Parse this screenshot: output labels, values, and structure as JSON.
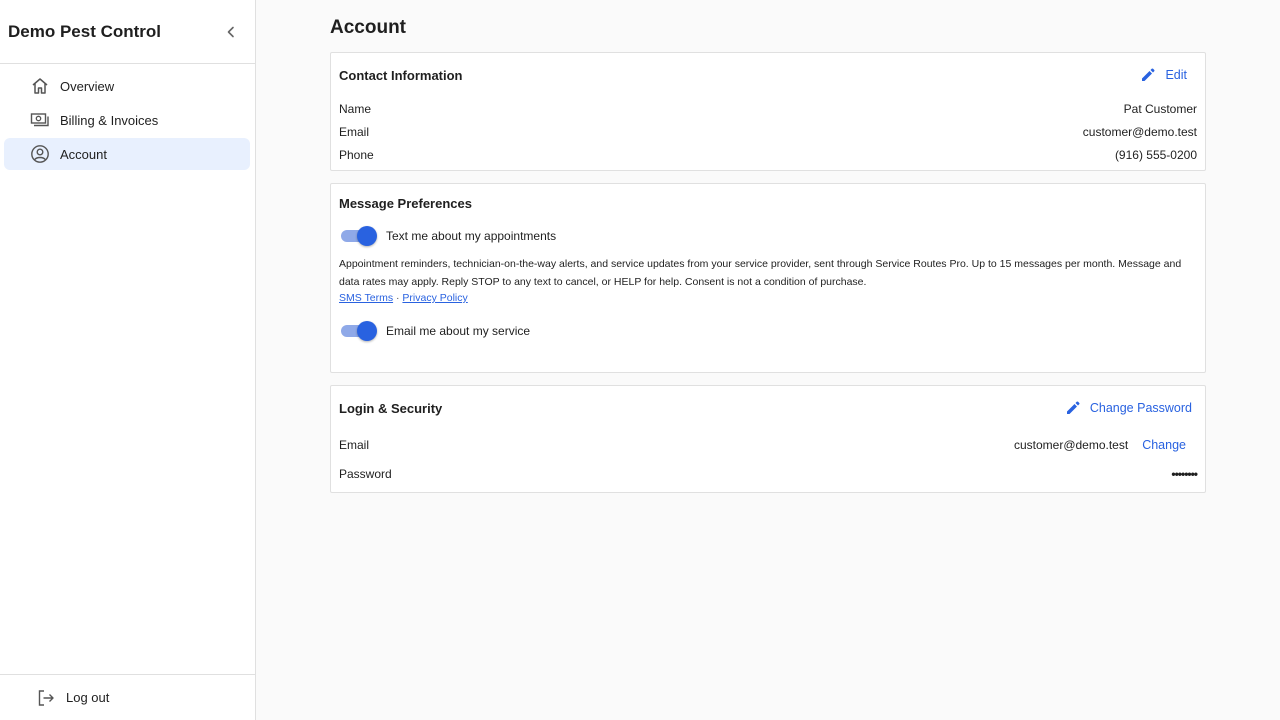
{
  "sidebar": {
    "brand": "Demo Pest Control",
    "items": [
      {
        "label": "Overview",
        "icon": "home-icon"
      },
      {
        "label": "Billing & Invoices",
        "icon": "cash-icon"
      },
      {
        "label": "Account",
        "icon": "account-circle-icon",
        "active": true
      }
    ],
    "logout_label": "Log out"
  },
  "page": {
    "title": "Account"
  },
  "contact": {
    "title": "Contact Information",
    "edit_label": "Edit",
    "rows": [
      {
        "label": "Name",
        "value": "Pat Customer"
      },
      {
        "label": "Email",
        "value": "customer@demo.test"
      },
      {
        "label": "Phone",
        "value": "(916) 555-0200"
      }
    ]
  },
  "prefs": {
    "title": "Message Preferences",
    "sms_toggle_label": "Text me about my appointments",
    "sms_enabled": true,
    "sms_description": "Appointment reminders, technician-on-the-way alerts, and service updates from your service provider, sent through Service Routes Pro. Up to 15 messages per month. Message and data rates may apply. Reply STOP to any text to cancel, or HELP for help. Consent is not a condition of purchase.",
    "sms_terms_label": "SMS Terms",
    "separator": "·",
    "privacy_label": "Privacy Policy",
    "email_toggle_label": "Email me about my service",
    "email_enabled": true
  },
  "security": {
    "title": "Login & Security",
    "change_password_label": "Change Password",
    "email_label": "Email",
    "email_value": "customer@demo.test",
    "change_label": "Change",
    "password_label": "Password",
    "password_value": "••••••••"
  },
  "colors": {
    "accent": "#2962e0",
    "active_nav_bg": "#e8f0fe",
    "toggle_track": "#8fa9e8"
  }
}
